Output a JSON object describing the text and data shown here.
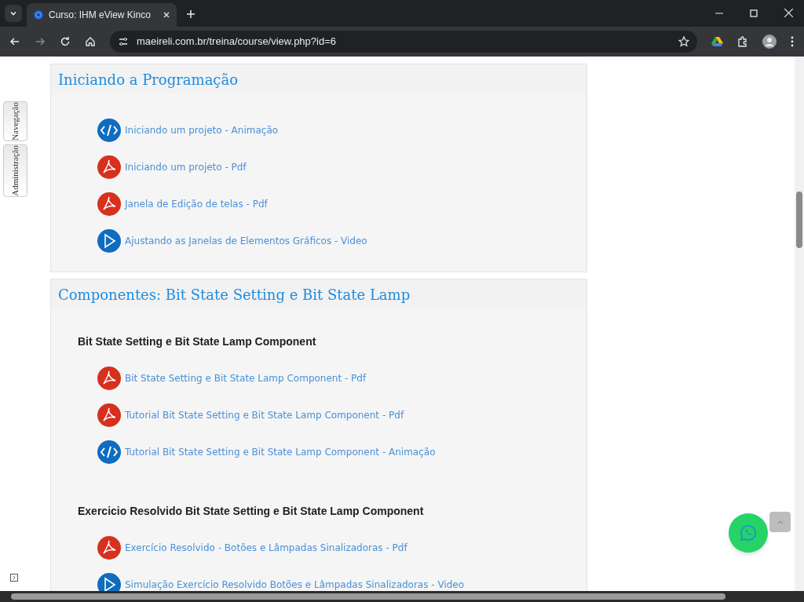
{
  "browser": {
    "tab_title": "Curso: IHM eView Kinco",
    "url": "maeireli.com.br/treina/course/view.php?id=6"
  },
  "side_tabs": [
    "Navegação",
    "Administração"
  ],
  "sections": [
    {
      "title": "Iniciando a Programação",
      "groups": [
        {
          "items": [
            {
              "kind": "animation",
              "label": "Iniciando um projeto - Animação"
            },
            {
              "kind": "pdf",
              "label": "Iniciando um projeto - Pdf"
            },
            {
              "kind": "pdf",
              "label": "Janela de Edição de telas - Pdf"
            },
            {
              "kind": "video",
              "label": "Ajustando as Janelas de Elementos Gráficos - Video"
            }
          ]
        }
      ]
    },
    {
      "title": "Componentes: Bit State Setting e Bit State Lamp",
      "groups": [
        {
          "heading": "Bit State Setting e Bit State Lamp Component",
          "items": [
            {
              "kind": "pdf",
              "label": "Bit State Setting e Bit State Lamp Component - Pdf"
            },
            {
              "kind": "pdf",
              "label": "Tutorial Bit State Setting e Bit State Lamp Component - Pdf"
            },
            {
              "kind": "animation",
              "label": "Tutorial Bit State Setting e Bit State Lamp Component - Animação"
            }
          ]
        },
        {
          "heading": "Exercicio Resolvido Bit State Setting e Bit State Lamp Component",
          "items": [
            {
              "kind": "pdf",
              "label": "Exercício Resolvido - Botões e Lâmpadas Sinalizadoras - Pdf"
            },
            {
              "kind": "video",
              "label": "Simulação Exercício Resolvido Botões e Lâmpadas Sinalizadoras - Video"
            }
          ]
        }
      ]
    }
  ]
}
